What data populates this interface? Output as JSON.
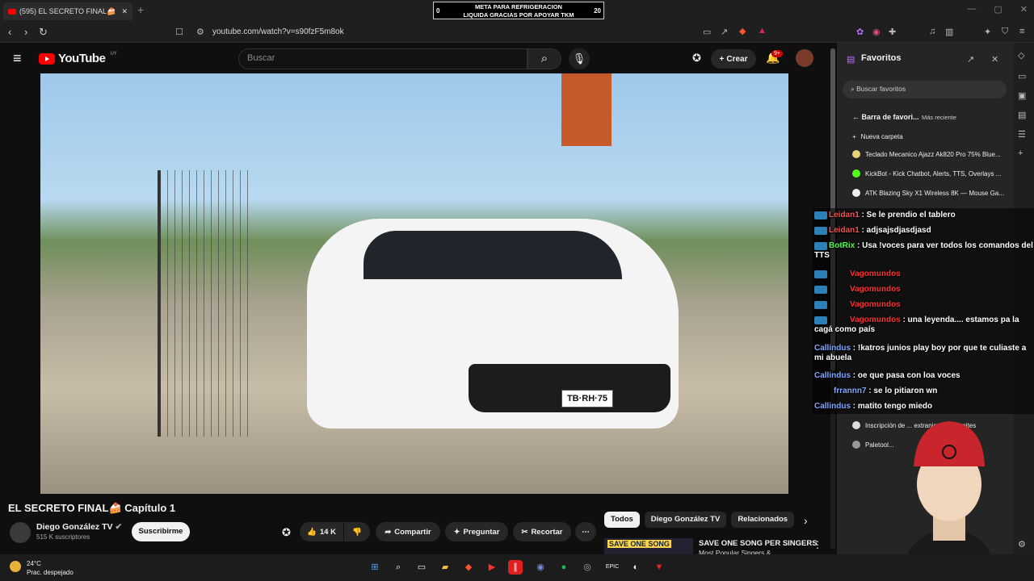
{
  "browser": {
    "tab_title": "(595) EL SECRETO FINAL🍰 C",
    "url": "youtube.com/watch?v=s90fzF5m8ok",
    "goal": {
      "left": "0",
      "line1": "META PARA REFRIGERACION",
      "line2": "LIQUIDA GRACIAS POR APOYAR TKM",
      "right": "20"
    }
  },
  "youtube": {
    "logo": "YouTube",
    "region": "UY",
    "search_placeholder": "Buscar",
    "create_label": "Crear",
    "notif_badge": "9+",
    "video_title": "EL SECRETO FINAL🍰 Capítulo 1",
    "channel_name": "Diego González TV",
    "subscribers": "515 K suscriptores",
    "subscribe_label": "Suscribirme",
    "likes": "14 K",
    "share_label": "Compartir",
    "ask_label": "Preguntar",
    "clip_label": "Recortar",
    "plate": "TB·RH·75",
    "chips": [
      "Todos",
      "Diego González TV",
      "Relacionados"
    ],
    "rec_thumb_text": "SAVE ONE SONG",
    "rec_title": "SAVE ONE SONG PER SINGERS",
    "rec_sub": "Most Popular Singers &"
  },
  "favorites": {
    "title": "Favoritos",
    "search_placeholder": "Buscar favoritos",
    "folder": "Barra de favori...",
    "sort": "Más reciente",
    "new_folder": "Nueva carpeta",
    "items": [
      "Teclado Mecanico Ajazz Ak820 Pro 75% Blue...",
      "KickBot - Kick Chatbot, Alerts, TTS, Overlays ...",
      "ATK Blazing Sky X1 Wireless 8K — Mouse Ga...",
      "Inscripción de ... extranjeras | Trámites",
      "Paletool..."
    ]
  },
  "chat": [
    {
      "user": "Leidan1",
      "text": ": Se le prendio el tablero",
      "color": "#ff4d4d"
    },
    {
      "user": "Leidan1",
      "text": ": adjsajsdjasdjasd",
      "color": "#ff4d4d"
    },
    {
      "user": "BotRix",
      "text": ": Usa !voces para ver todos los comandos del TTS",
      "color": "#4cff4c"
    },
    {
      "user": "Vagomundos",
      "text": "",
      "color": "#ff3030"
    },
    {
      "user": "Vagomundos",
      "text": "",
      "color": "#ff3030"
    },
    {
      "user": "Vagomundos",
      "text": "",
      "color": "#ff3030"
    },
    {
      "user": "Vagomundos",
      "text": ": una leyenda.... estamos pa la cagá como país",
      "color": "#ff3030"
    },
    {
      "user": "Callindus",
      "text": ": !katros junios play boy por que te culiaste a mi abuela",
      "color": "#7fa7ff"
    },
    {
      "user": "Callindus",
      "text": ": oe que pasa con loa voces",
      "color": "#7fa7ff"
    },
    {
      "user": "frrannn7",
      "text": ": se lo pitiaron wn",
      "color": "#7fa7ff"
    },
    {
      "user": "Callindus",
      "text": ": matito tengo miedo",
      "color": "#7fa7ff"
    }
  ],
  "taskbar": {
    "temp": "24°C",
    "weather": "Prac. despejado"
  },
  "colors": {
    "yt_red": "#ff0000",
    "bg": "#0f0f0f"
  }
}
